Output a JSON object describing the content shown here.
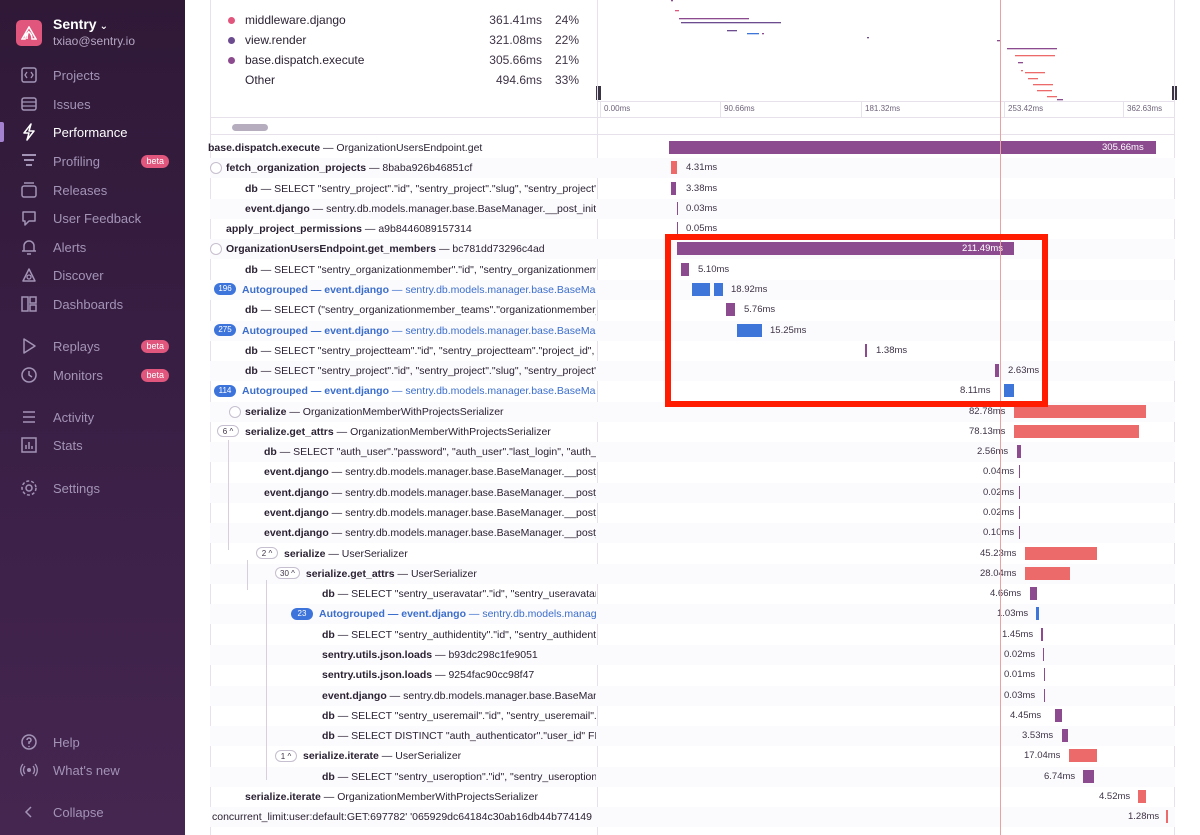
{
  "sidebar": {
    "org_name": "Sentry",
    "org_email": "txiao@sentry.io",
    "items": [
      {
        "label": "Projects",
        "icon": "projects-icon"
      },
      {
        "label": "Issues",
        "icon": "issues-icon"
      },
      {
        "label": "Performance",
        "icon": "performance-icon",
        "active": true
      },
      {
        "label": "Profiling",
        "icon": "profiling-icon",
        "badge": "beta"
      },
      {
        "label": "Releases",
        "icon": "releases-icon"
      },
      {
        "label": "User Feedback",
        "icon": "user-feedback-icon"
      },
      {
        "label": "Alerts",
        "icon": "alerts-icon"
      },
      {
        "label": "Discover",
        "icon": "discover-icon"
      },
      {
        "label": "Dashboards",
        "icon": "dashboards-icon"
      },
      {
        "label": "Replays",
        "icon": "replays-icon",
        "badge": "beta"
      },
      {
        "label": "Monitors",
        "icon": "monitors-icon",
        "badge": "beta"
      },
      {
        "label": "Activity",
        "icon": "activity-icon"
      },
      {
        "label": "Stats",
        "icon": "stats-icon"
      },
      {
        "label": "Settings",
        "icon": "settings-icon"
      },
      {
        "label": "Help",
        "icon": "help-icon"
      },
      {
        "label": "What's new",
        "icon": "whats-new-icon"
      },
      {
        "label": "Collapse",
        "icon": "collapse-icon"
      }
    ]
  },
  "ops_breakdown": [
    {
      "name": "middleware.django",
      "duration": "361.41ms",
      "percent": "24%",
      "color": "#e1567c"
    },
    {
      "name": "view.render",
      "duration": "321.08ms",
      "percent": "22%",
      "color": "#6c4b8f"
    },
    {
      "name": "base.dispatch.execute",
      "duration": "305.66ms",
      "percent": "21%",
      "color": "#8c4b8f"
    },
    {
      "name": "Other",
      "duration": "494.6ms",
      "percent": "33%",
      "color": ""
    }
  ],
  "minimap_ticks": [
    "0.00ms",
    "90.66ms",
    "181.32ms",
    "253.42ms",
    "362.63ms"
  ],
  "colors": {
    "purple": "#8c4b8f",
    "pink": "#ed6a6a",
    "blue": "#3e75d9",
    "highlight": "#ff1c00"
  },
  "spans": [
    {
      "op": "base.dispatch.execute",
      "desc": "OrganizationUsersEndpoint.get",
      "dur": "305.66ms"
    },
    {
      "op": "fetch_organization_projects",
      "desc": "8baba926b46851cf",
      "dur": "4.31ms"
    },
    {
      "op": "db",
      "desc": "SELECT \"sentry_project\".\"id\", \"sentry_project\".\"slug\", \"sentry_project\"",
      "dur": "3.38ms"
    },
    {
      "op": "event.django",
      "desc": "sentry.db.models.manager.base.BaseManager.__post_init",
      "dur": "0.03ms"
    },
    {
      "op": "apply_project_permissions",
      "desc": "a9b8446089157314",
      "dur": "0.05ms"
    },
    {
      "op": "OrganizationUsersEndpoint.get_members",
      "desc": "bc781dd73296c4ad",
      "dur": "211.49ms"
    },
    {
      "op": "db",
      "desc": "SELECT \"sentry_organizationmember\".\"id\", \"sentry_organizationmem",
      "dur": "5.10ms"
    },
    {
      "op": "Autogrouped — event.django",
      "desc": "sentry.db.models.manager.base.BaseManag",
      "dur": "18.92ms",
      "badge": "196"
    },
    {
      "op": "db",
      "desc": "SELECT (\"sentry_organizationmember_teams\".\"organizationmember_",
      "dur": "5.76ms"
    },
    {
      "op": "Autogrouped — event.django",
      "desc": "sentry.db.models.manager.base.BaseManag",
      "dur": "15.25ms",
      "badge": "275"
    },
    {
      "op": "db",
      "desc": "SELECT \"sentry_projectteam\".\"id\", \"sentry_projectteam\".\"project_id\",",
      "dur": "1.38ms"
    },
    {
      "op": "db",
      "desc": "SELECT \"sentry_project\".\"id\", \"sentry_project\".\"slug\", \"sentry_project\"",
      "dur": "2.63ms"
    },
    {
      "op": "Autogrouped — event.django",
      "desc": "sentry.db.models.manager.base.BaseManag",
      "dur": "8.11ms",
      "badge": "114"
    },
    {
      "op": "serialize",
      "desc": "OrganizationMemberWithProjectsSerializer",
      "dur": "82.78ms"
    },
    {
      "op": "serialize.get_attrs",
      "desc": "OrganizationMemberWithProjectsSerializer",
      "dur": "78.13ms",
      "badge": "6"
    },
    {
      "op": "db",
      "desc": "SELECT \"auth_user\".\"password\", \"auth_user\".\"last_login\", \"auth_u",
      "dur": "2.56ms"
    },
    {
      "op": "event.django",
      "desc": "sentry.db.models.manager.base.BaseManager.__post_",
      "dur": "0.04ms"
    },
    {
      "op": "event.django",
      "desc": "sentry.db.models.manager.base.BaseManager.__post_",
      "dur": "0.02ms"
    },
    {
      "op": "event.django",
      "desc": "sentry.db.models.manager.base.BaseManager.__post_",
      "dur": "0.02ms"
    },
    {
      "op": "event.django",
      "desc": "sentry.db.models.manager.base.BaseManager.__post_",
      "dur": "0.10ms"
    },
    {
      "op": "serialize",
      "desc": "UserSerializer",
      "dur": "45.23ms",
      "badge": "2"
    },
    {
      "op": "serialize.get_attrs",
      "desc": "UserSerializer",
      "dur": "28.04ms",
      "badge": "30"
    },
    {
      "op": "db",
      "desc": "SELECT \"sentry_useravatar\".\"id\", \"sentry_useravatar\".\"file",
      "dur": "4.66ms"
    },
    {
      "op": "Autogrouped — event.django",
      "desc": "sentry.db.models.manager.bas",
      "dur": "1.03ms",
      "badge": "23"
    },
    {
      "op": "db",
      "desc": "SELECT \"sentry_authidentity\".\"id\", \"sentry_authidentity\".",
      "dur": "1.45ms"
    },
    {
      "op": "sentry.utils.json.loads",
      "desc": "b93dc298c1fe9051",
      "dur": "0.02ms"
    },
    {
      "op": "sentry.utils.json.loads",
      "desc": "9254fac90cc98f47",
      "dur": "0.01ms"
    },
    {
      "op": "event.django",
      "desc": "sentry.db.models.manager.base.BaseManager.",
      "dur": "0.03ms"
    },
    {
      "op": "db",
      "desc": "SELECT \"sentry_useremail\".\"id\", \"sentry_useremail\".\"user_",
      "dur": "4.45ms"
    },
    {
      "op": "db",
      "desc": "SELECT DISTINCT \"auth_authenticator\".\"user_id\" FROM \"",
      "dur": "3.53ms"
    },
    {
      "op": "serialize.iterate",
      "desc": "UserSerializer",
      "dur": "17.04ms",
      "badge": "1"
    },
    {
      "op": "db",
      "desc": "SELECT \"sentry_useroption\".\"id\", \"sentry_useroption\".\"use",
      "dur": "6.74ms"
    },
    {
      "op": "serialize.iterate",
      "desc": "OrganizationMemberWithProjectsSerializer",
      "dur": "4.52ms"
    },
    {
      "op": "",
      "desc": "concurrent_limit:user:default:GET:697782' '065929dc64184c30ab16db44b774149",
      "dur": "1.28ms"
    }
  ]
}
